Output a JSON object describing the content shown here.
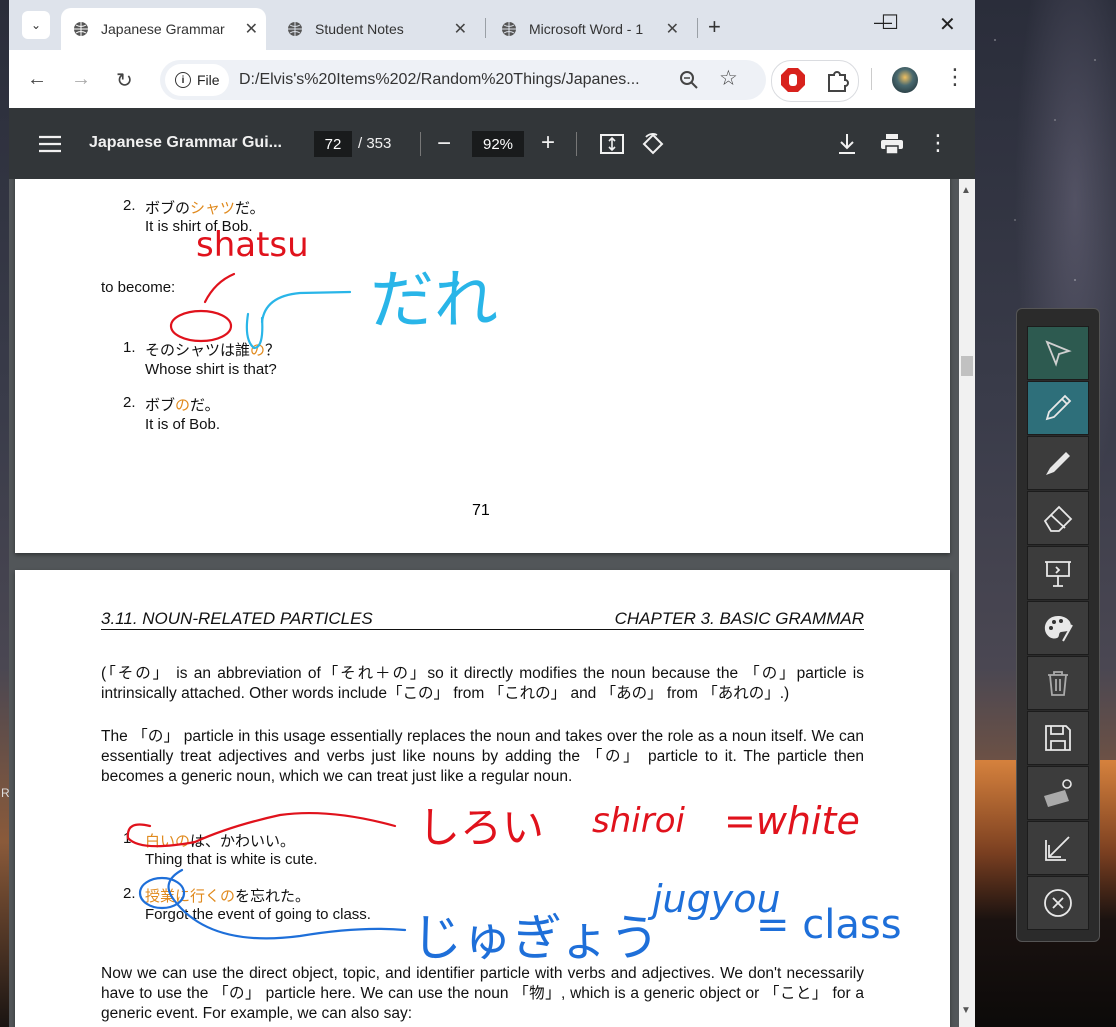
{
  "tabs": [
    {
      "title": "Japanese Grammar",
      "active": true
    },
    {
      "title": "Student Notes",
      "active": false
    },
    {
      "title": "Microsoft Word - 1",
      "active": false
    }
  ],
  "address": {
    "chip": "File",
    "url": "D:/Elvis's%20Items%202/Random%20Things/Japanes..."
  },
  "pdf": {
    "title": "Japanese Grammar Gui...",
    "page": "72",
    "total": "/ 353",
    "zoom": "92%"
  },
  "page1": {
    "ex2_num": "2.",
    "ex2_jp_a": "ボブの",
    "ex2_jp_b": "シャツ",
    "ex2_jp_c": "だ。",
    "ex2_en": "It is shirt of Bob.",
    "to_become": "to become:",
    "b1_num": "1.",
    "b1_jp_a": "そのシャツは誰",
    "b1_jp_b": "の",
    "b1_jp_c": "？",
    "b1_en": "Whose shirt is that?",
    "b2_num": "2.",
    "b2_jp_a": "ボブ",
    "b2_jp_b": "の",
    "b2_jp_c": "だ。",
    "b2_en": "It is of Bob.",
    "page_number": "71"
  },
  "page2": {
    "section": "3.11.  NOUN-RELATED PARTICLES",
    "chapter": "CHAPTER 3.  BASIC GRAMMAR",
    "p1": "(「その」 is an abbreviation of「それ＋の」so it directly modifies the noun because the 「の」particle is intrinsically attached. Other words include「この」 from 「これの」 and 「あの」 from 「あれの」.)",
    "p2": "The 「の」 particle in this usage essentially replaces the noun and takes over the role as a noun itself. We can essentially treat adjectives and verbs just like nouns by adding the 「の」 particle to it. The particle then becomes a generic noun, which we can treat just like a regular noun.",
    "c1_num": "1.",
    "c1_jp_a": "白いの",
    "c1_jp_b": "は、かわいい。",
    "c1_en": "Thing that is white is cute.",
    "c2_num": "2.",
    "c2_jp_a": "授業に行くの",
    "c2_jp_b": "を忘れた。",
    "c2_en": "Forgot the event of going to class.",
    "p3": "Now we can use the direct object, topic, and identifier particle with verbs and adjectives. We don't necessarily have to use the 「の」 particle here. We can use the noun 「物」, which is a generic object or 「こと」 for a generic event. For example, we can also say:"
  },
  "annotations": {
    "shatsu": "shatsu",
    "dare": "だれ",
    "shiroi_kana": "しろい",
    "shiroi": "shiroi",
    "white": "=white",
    "jugyou_kana": "じゅぎょう",
    "jugyou": "jugyou",
    "class": "= class"
  },
  "desktop": {
    "edge_char": "R"
  },
  "tools": [
    "pointer-icon",
    "pen-icon",
    "highlighter-icon",
    "eraser-icon",
    "whiteboard-icon",
    "palette-icon",
    "trash-icon",
    "save-icon",
    "keyboard-settings-icon",
    "collapse-icon",
    "close-circle-icon"
  ],
  "colors": {
    "ink_red": "#e0121c",
    "ink_blue": "#1e6fd9",
    "ink_cyan": "#29b5e8",
    "accent_orange": "#e08a1e",
    "tool_active": "#2d5a50"
  }
}
